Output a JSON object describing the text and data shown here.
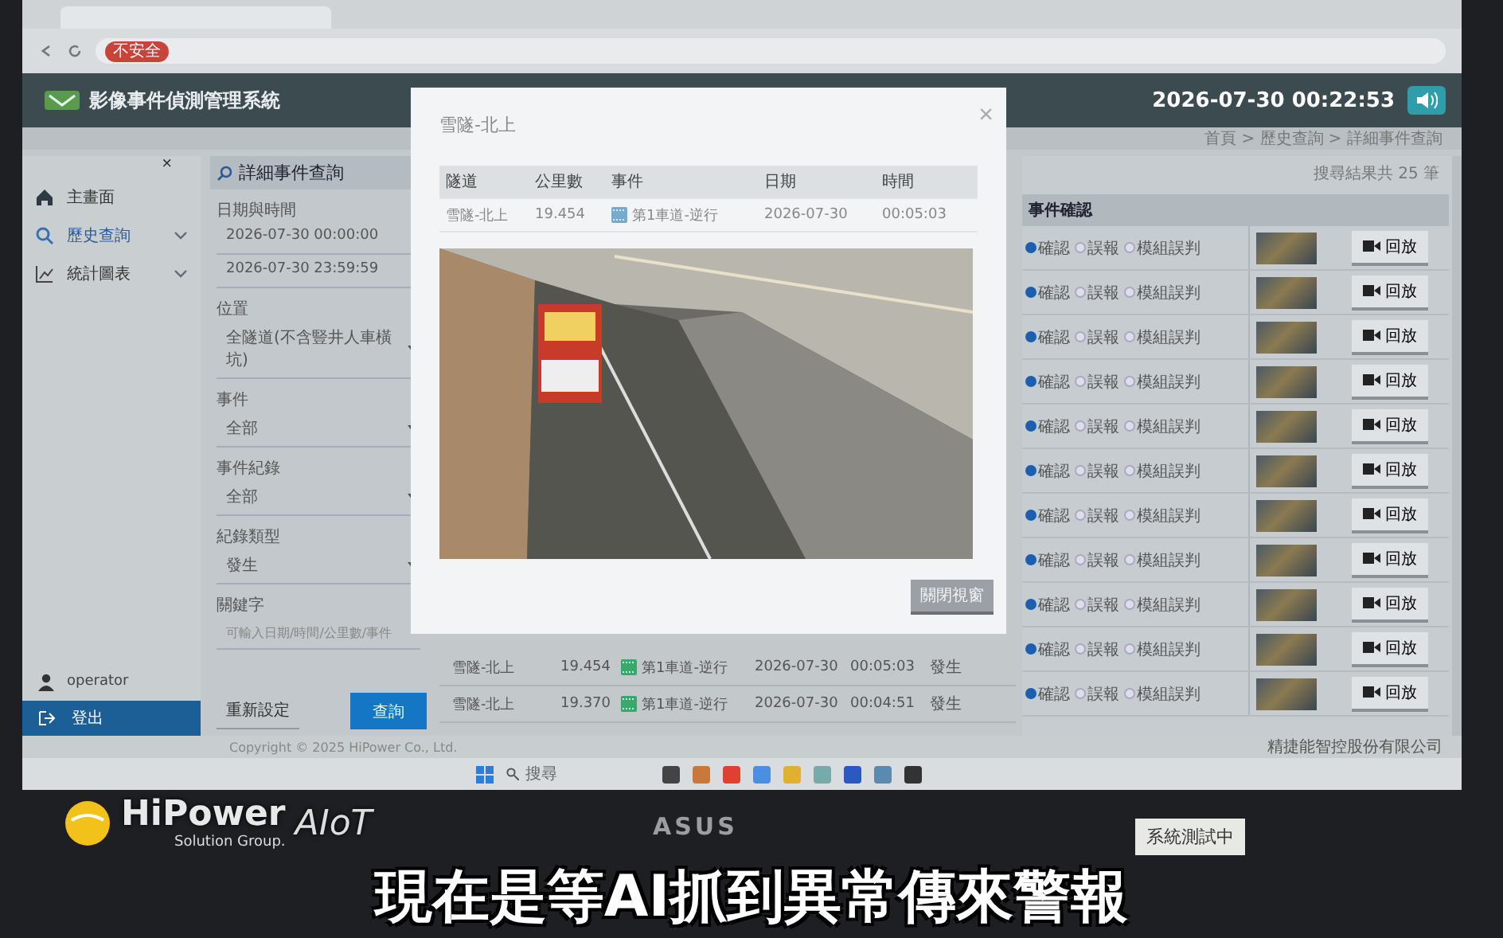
{
  "browser": {
    "security_badge": "不安全"
  },
  "header": {
    "title": "影像事件偵測管理系統",
    "clock": "2026-07-30 00:22:53",
    "breadcrumb": "首頁 > 歷史查詢 > 詳細事件查詢"
  },
  "sidebar": {
    "close": "×",
    "items": [
      {
        "label": "主畫面",
        "selected": false,
        "submenu": false
      },
      {
        "label": "歷史查詢",
        "selected": true,
        "submenu": true
      },
      {
        "label": "統計圖表",
        "selected": false,
        "submenu": true
      }
    ],
    "user": "operator",
    "logout": "登出"
  },
  "filter": {
    "title": "詳細事件查詢",
    "date_label": "日期與時間",
    "date_from": "2026-07-30 00:00:00",
    "date_to": "2026-07-30 23:59:59",
    "selects": [
      {
        "label": "位置",
        "value": "全隧道(不含豎井人車橫坑)"
      },
      {
        "label": "事件",
        "value": "全部"
      },
      {
        "label": "事件紀錄",
        "value": "全部"
      },
      {
        "label": "紀錄類型",
        "value": "發生"
      }
    ],
    "keyword_label": "關鍵字",
    "keyword_placeholder": "可輸入日期/時間/公里數/事件",
    "reset": "重新設定",
    "search": "查詢"
  },
  "events_table": {
    "rows": [
      [
        "雪隧-北上",
        "19.454",
        "第1車道-逆行",
        "2026-07-30",
        "00:05:03",
        "發生"
      ],
      [
        "雪隧-北上",
        "19.370",
        "第1車道-逆行",
        "2026-07-30",
        "00:04:51",
        "發生"
      ]
    ]
  },
  "results": {
    "count": "搜尋結果共 25 筆",
    "header": "事件確認",
    "rows": [
      {
        "options": [
          {
            "label": "確認",
            "selected": true
          },
          {
            "label": "誤報",
            "selected": false
          },
          {
            "label": "模組誤判",
            "selected": false
          }
        ],
        "replay": "回放"
      },
      {
        "options": [
          {
            "label": "確認",
            "selected": true
          },
          {
            "label": "誤報",
            "selected": false
          },
          {
            "label": "模組誤判",
            "selected": false
          }
        ],
        "replay": "回放"
      },
      {
        "options": [
          {
            "label": "確認",
            "selected": true
          },
          {
            "label": "誤報",
            "selected": false
          },
          {
            "label": "模組誤判",
            "selected": false
          }
        ],
        "replay": "回放"
      },
      {
        "options": [
          {
            "label": "確認",
            "selected": true
          },
          {
            "label": "誤報",
            "selected": false
          },
          {
            "label": "模組誤判",
            "selected": false
          }
        ],
        "replay": "回放"
      },
      {
        "options": [
          {
            "label": "確認",
            "selected": true
          },
          {
            "label": "誤報",
            "selected": false
          },
          {
            "label": "模組誤判",
            "selected": false
          }
        ],
        "replay": "回放"
      },
      {
        "options": [
          {
            "label": "確認",
            "selected": true
          },
          {
            "label": "誤報",
            "selected": false
          },
          {
            "label": "模組誤判",
            "selected": false
          }
        ],
        "replay": "回放"
      },
      {
        "options": [
          {
            "label": "確認",
            "selected": true
          },
          {
            "label": "誤報",
            "selected": false
          },
          {
            "label": "模組誤判",
            "selected": false
          }
        ],
        "replay": "回放"
      },
      {
        "options": [
          {
            "label": "確認",
            "selected": true
          },
          {
            "label": "誤報",
            "selected": false
          },
          {
            "label": "模組誤判",
            "selected": false
          }
        ],
        "replay": "回放"
      },
      {
        "options": [
          {
            "label": "確認",
            "selected": true
          },
          {
            "label": "誤報",
            "selected": false
          },
          {
            "label": "模組誤判",
            "selected": false
          }
        ],
        "replay": "回放"
      },
      {
        "options": [
          {
            "label": "確認",
            "selected": true
          },
          {
            "label": "誤報",
            "selected": false
          },
          {
            "label": "模組誤判",
            "selected": false
          }
        ],
        "replay": "回放"
      },
      {
        "options": [
          {
            "label": "確認",
            "selected": true
          },
          {
            "label": "誤報",
            "selected": false
          },
          {
            "label": "模組誤判",
            "selected": false
          }
        ],
        "replay": "回放"
      }
    ]
  },
  "modal": {
    "title": "雪隧-北上",
    "close": "×",
    "columns": [
      "隧道",
      "公里數",
      "事件",
      "日期",
      "時間"
    ],
    "row": [
      "雪隧-北上",
      "19.454",
      "第1車道-逆行",
      "2026-07-30",
      "00:05:03"
    ],
    "button": "關閉視窗"
  },
  "footer": {
    "copyright": "Copyright © 2025 HiPower Co., Ltd.",
    "company": "精捷能智控股份有限公司"
  },
  "taskbar": {
    "search": "搜尋"
  },
  "bezel": {
    "brand": "ASUS",
    "note": "系統測試中"
  },
  "overlay": {
    "logo_name": "HiPower",
    "logo_sub": "Solution Group.",
    "logo_tag": "AIoT",
    "subtitle": "現在是等AI抓到異常傳來警報"
  }
}
